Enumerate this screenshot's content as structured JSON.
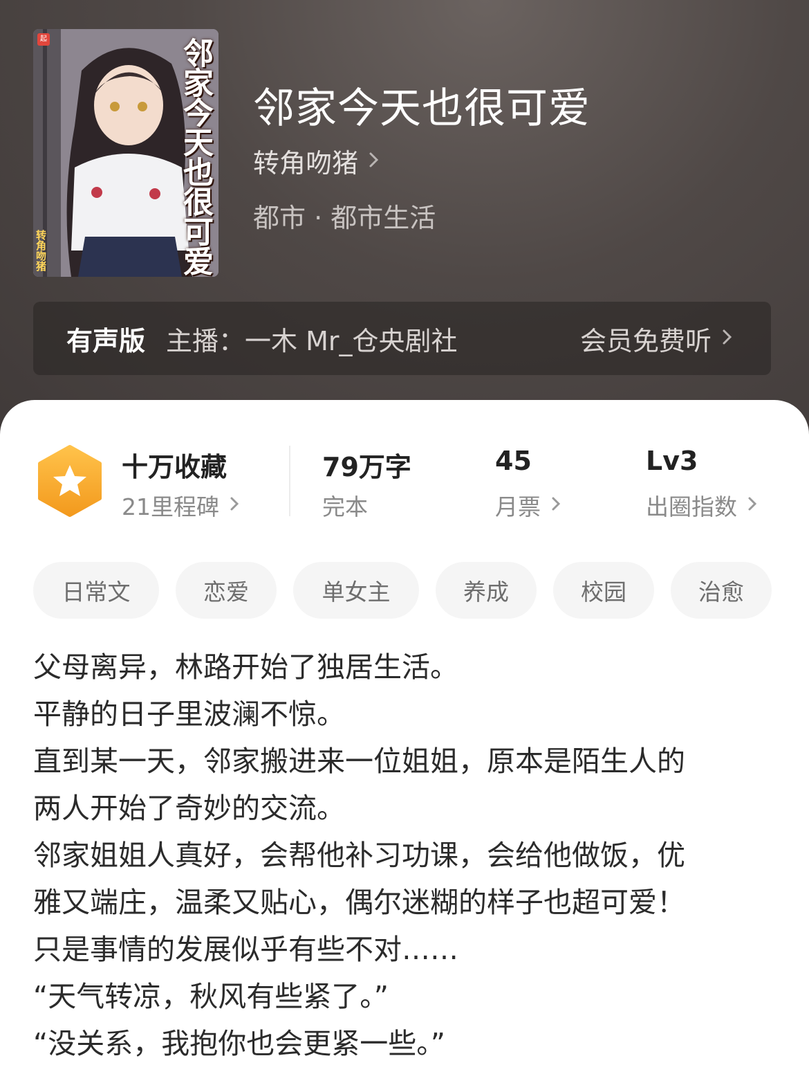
{
  "header": {
    "cover_title": "邻家今天也很可爱",
    "cover_author": "转角吻猪",
    "title": "邻家今天也很可爱",
    "author": "转角吻猪",
    "genre": "都市 · 都市生活"
  },
  "audio": {
    "label": "有声版",
    "host": "主播：一木 Mr_仓央剧社",
    "cta": "会员免费听"
  },
  "stats": {
    "favorites": {
      "value": "十万收藏",
      "sub": "21里程碑"
    },
    "words": {
      "value": "79万字",
      "sub": "完本"
    },
    "monthly_votes": {
      "value": "45",
      "sub": "月票"
    },
    "level": {
      "value": "Lv3",
      "sub": "出圈指数"
    }
  },
  "tags": [
    "日常文",
    "恋爱",
    "单女主",
    "养成",
    "校园",
    "治愈"
  ],
  "description": [
    "父母离异，林路开始了独居生活。",
    "平静的日子里波澜不惊。",
    "直到某一天，邻家搬进来一位姐姐，原本是陌生人的",
    "两人开始了奇妙的交流。",
    "邻家姐姐人真好，会帮他补习功课，会给他做饭，优",
    "雅又端庄，温柔又贴心，偶尔迷糊的样子也超可爱！",
    "只是事情的发展似乎有些不对……",
    "“天气转凉，秋风有些紧了。”",
    "“没关系，我抱你也会更紧一些。”"
  ],
  "colors": {
    "accent_orange": "#f5a623",
    "header_bg": "#4f4846"
  }
}
